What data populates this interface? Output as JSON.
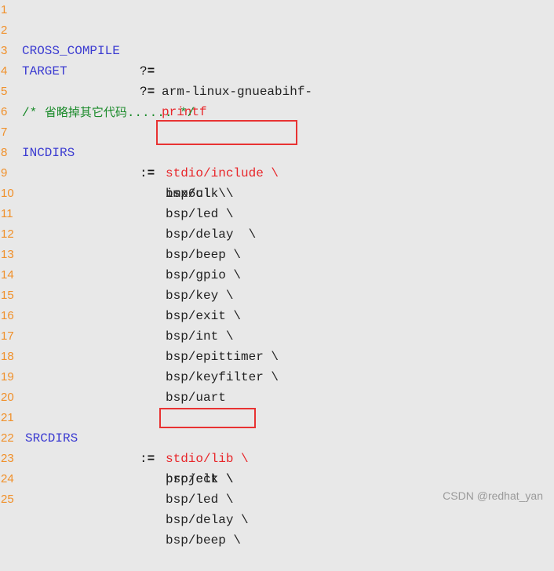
{
  "code": {
    "line_numbers": [
      "1",
      "2",
      "3",
      "4",
      "5",
      "6",
      "7",
      "8",
      "9",
      "10",
      "11",
      "12",
      "13",
      "14",
      "15",
      "16",
      "17",
      "18",
      "19",
      "20",
      "21",
      "22",
      "23",
      "24",
      "25"
    ],
    "line1": {
      "var": "CROSS_COMPILE",
      "op": "?=",
      "value": "arm-linux-gnueabihf-"
    },
    "line2": {
      "var": "TARGET",
      "op": "?=",
      "value": "printf"
    },
    "line4": {
      "comment_open": "/* ",
      "comment_text": "省略掉其它代码",
      "comment_close": "...... */"
    },
    "incdirs": {
      "var": "INCDIRS",
      "op": ":=",
      "values": [
        "imx6ul \\",
        "stdio/include \\",
        "bsp/clk \\",
        "bsp/led \\",
        "bsp/delay  \\",
        "bsp/beep \\",
        "bsp/gpio \\",
        "bsp/key \\",
        "bsp/exit \\",
        "bsp/int \\",
        "bsp/epittimer \\",
        "bsp/keyfilter \\",
        "bsp/uart"
      ]
    },
    "srcdirs": {
      "var": "SRCDIRS",
      "op": ":=",
      "values": [
        "project \\",
        "stdio/lib \\",
        "bsp/clk \\",
        "bsp/led \\",
        "bsp/delay \\",
        "bsp/beep \\"
      ]
    }
  },
  "highlights": [
    "stdio/include \\",
    "stdio/lib \\"
  ],
  "colors": {
    "background": "#e8e8e8",
    "line_number": "#f0902a",
    "keyword": "#3b3bd1",
    "string_red": "#e8262a",
    "comment": "#1a8a2a",
    "highlight_box": "#e83232"
  },
  "watermark": "CSDN @redhat_yan"
}
